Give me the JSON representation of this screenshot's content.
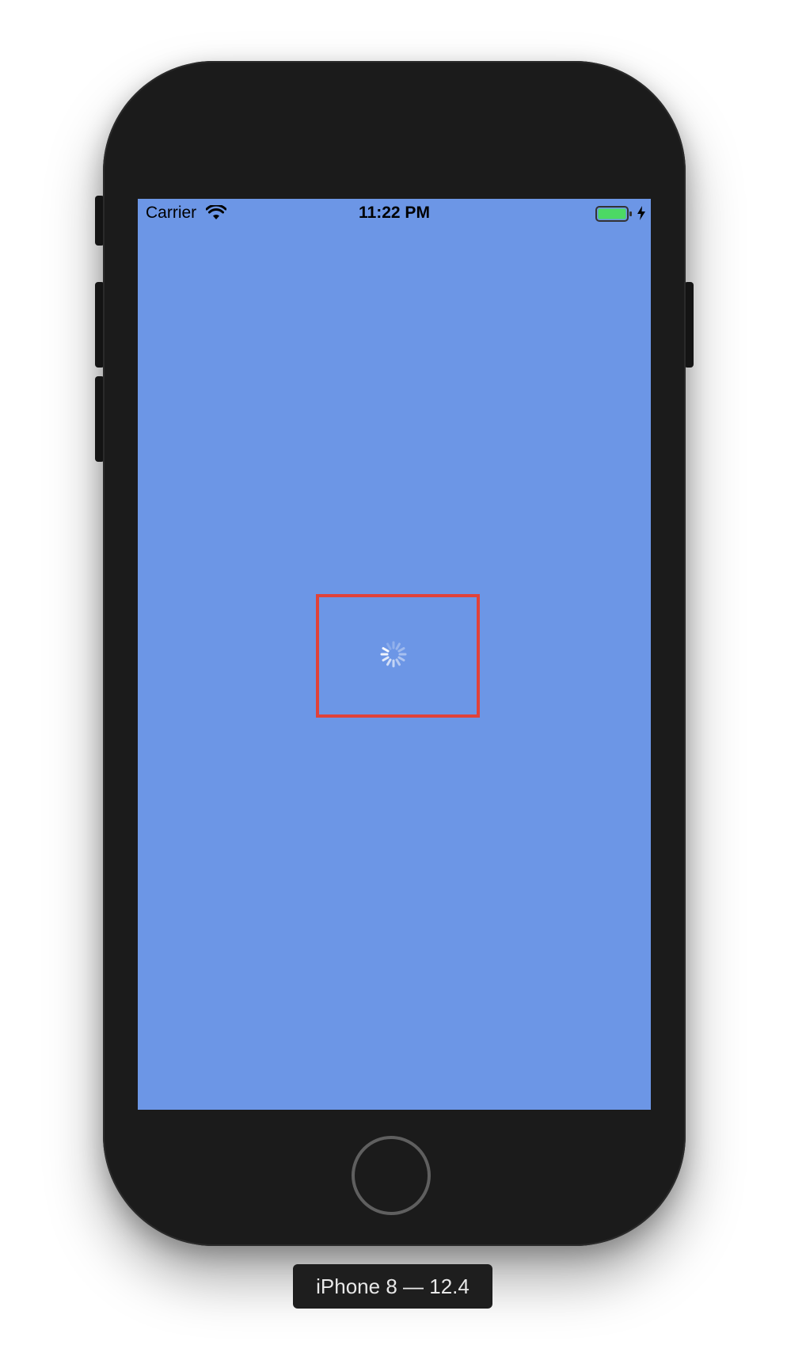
{
  "status_bar": {
    "carrier": "Carrier",
    "time": "11:22 PM",
    "battery_state": "charging",
    "battery_color": "#4cd964"
  },
  "screen": {
    "background_color": "#6c96e6",
    "loader": {
      "icon": "activity-indicator-icon",
      "highlight_color": "#e0423a"
    }
  },
  "device_label": "iPhone 8 — 12.4"
}
